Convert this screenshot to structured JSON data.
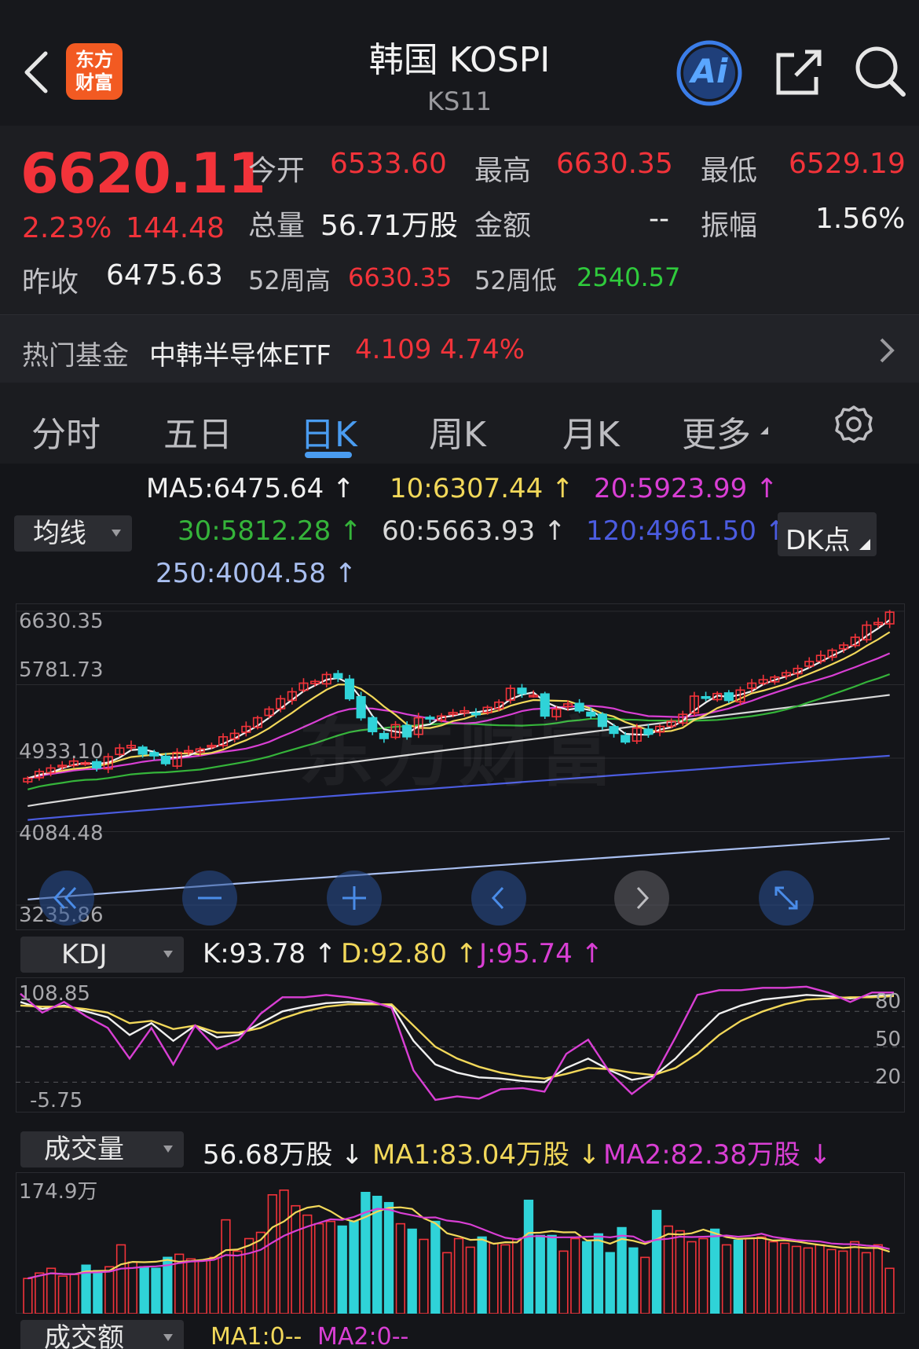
{
  "header": {
    "logo_line1": "东方",
    "logo_line2": "财富",
    "title": "韩国 KOSPI",
    "code": "KS11",
    "ai_label": "Ai"
  },
  "quote": {
    "price": "6620.11",
    "change_pct": "2.23%",
    "change": "144.48",
    "prev_close_label": "昨收",
    "prev_close": "6475.63",
    "open_label": "今开",
    "open": "6533.60",
    "high_label": "最高",
    "high": "6630.35",
    "low_label": "最低",
    "low": "6529.19",
    "volume_label": "总量",
    "volume": "56.71万股",
    "amount_label": "金额",
    "amount": "--",
    "amplitude_label": "振幅",
    "amplitude": "1.56%",
    "wk52_high_label": "52周高",
    "wk52_high": "6630.35",
    "wk52_low_label": "52周低",
    "wk52_low": "2540.57"
  },
  "fund": {
    "label": "热门基金",
    "name": "中韩半导体ETF",
    "price": "4.109",
    "pct": "4.74%"
  },
  "tabs": [
    "分时",
    "五日",
    "日K",
    "周K",
    "月K",
    "更多"
  ],
  "ma": {
    "selector": "均线",
    "dk_label": "DK点",
    "items": [
      {
        "text": "MA5:6475.64 ↑",
        "color": "#f0f0f0"
      },
      {
        "text": "10:6307.44 ↑",
        "color": "#f2d85a"
      },
      {
        "text": "20:5923.99 ↑",
        "color": "#d93fd4"
      },
      {
        "text": "30:5812.28 ↑",
        "color": "#35b43a"
      },
      {
        "text": "60:5663.93 ↑",
        "color": "#d8d8d8"
      },
      {
        "text": "120:4961.50 ↑",
        "color": "#4b5ce0"
      },
      {
        "text": "250:4004.58 ↑",
        "color": "#a9bff0"
      }
    ]
  },
  "kline_axis": [
    "6630.35",
    "5781.73",
    "4933.10",
    "4084.48",
    "3235.86"
  ],
  "watermark": "东方财富",
  "kdj": {
    "selector": "KDJ",
    "k": "K:93.78 ↑",
    "d": "D:92.80 ↑",
    "j": "J:95.74 ↑",
    "axis_top": "108.85",
    "axis_bottom": "-5.75",
    "levels": [
      "80",
      "50",
      "20"
    ]
  },
  "volume": {
    "selector": "成交量",
    "vol": "56.68万股 ↓",
    "ma1": "MA1:83.04万股 ↓",
    "ma2": "MA2:82.38万股 ↓",
    "axis_top": "174.9万"
  },
  "amount_panel": {
    "selector": "成交额",
    "ma1": "MA1:0--",
    "ma2": "MA2:0--"
  },
  "colors": {
    "up": "#f2333a",
    "down": "#2fd3d8",
    "accent": "#4a9cf0"
  },
  "chart_data": [
    {
      "type": "candlestick",
      "title": "",
      "ylim": [
        3235.86,
        6630.35
      ],
      "y_ticks": [
        6630.35,
        5781.73,
        4933.1,
        4084.48,
        3235.86
      ],
      "series_close": [
        4700,
        4780,
        4820,
        4850,
        4900,
        4880,
        4820,
        4950,
        5050,
        5080,
        4980,
        4960,
        4870,
        5000,
        5020,
        5040,
        5080,
        5180,
        5220,
        5300,
        5400,
        5500,
        5620,
        5700,
        5800,
        5820,
        5900,
        5860,
        5620,
        5400,
        5240,
        5160,
        5320,
        5180,
        5400,
        5390,
        5420,
        5460,
        5480,
        5450,
        5520,
        5580,
        5740,
        5680,
        5660,
        5420,
        5500,
        5560,
        5480,
        5420,
        5300,
        5220,
        5120,
        5280,
        5210,
        5300,
        5360,
        5440,
        5650,
        5640,
        5680,
        5600,
        5720,
        5800,
        5840,
        5870,
        5920,
        5970,
        6050,
        6120,
        6180,
        6240,
        6330,
        6470,
        6500,
        6620
      ],
      "ma_latest": {
        "MA5": 6475.64,
        "MA10": 6307.44,
        "MA20": 5923.99,
        "MA30": 5812.28,
        "MA60": 5663.93,
        "MA120": 4961.5,
        "MA250": 4004.58
      }
    },
    {
      "type": "line",
      "title": "",
      "ylim": [
        -5.75,
        108.85
      ],
      "series": [
        {
          "name": "K",
          "values": [
            88,
            82,
            85,
            80,
            75,
            60,
            70,
            55,
            68,
            58,
            60,
            70,
            80,
            84,
            87,
            88,
            87,
            85,
            55,
            35,
            28,
            24,
            23,
            21,
            20,
            32,
            40,
            30,
            22,
            25,
            40,
            60,
            78,
            85,
            90,
            92,
            94,
            93,
            91,
            93,
            94
          ]
        },
        {
          "name": "D",
          "values": [
            85,
            84,
            84,
            82,
            79,
            70,
            72,
            65,
            68,
            62,
            62,
            66,
            74,
            80,
            84,
            86,
            86,
            86,
            68,
            50,
            40,
            33,
            28,
            25,
            23,
            27,
            32,
            31,
            28,
            26,
            32,
            44,
            60,
            72,
            80,
            86,
            90,
            91,
            92,
            92,
            93
          ]
        },
        {
          "name": "J",
          "values": [
            95,
            79,
            88,
            76,
            66,
            40,
            66,
            35,
            68,
            48,
            56,
            78,
            92,
            92,
            94,
            92,
            89,
            83,
            30,
            5,
            8,
            6,
            14,
            15,
            12,
            44,
            56,
            28,
            10,
            24,
            58,
            94,
            98,
            98,
            100,
            100,
            101,
            96,
            88,
            96,
            96
          ]
        }
      ]
    },
    {
      "type": "bar",
      "title": "",
      "ylim": [
        0,
        174.9
      ],
      "series": [
        {
          "name": "成交量",
          "values": [
            45,
            52,
            58,
            48,
            50,
            62,
            55,
            60,
            88,
            66,
            60,
            58,
            72,
            76,
            70,
            68,
            72,
            120,
            80,
            96,
            104,
            152,
            158,
            138,
            126,
            115,
            118,
            112,
            118,
            155,
            150,
            142,
            115,
            108,
            95,
            118,
            78,
            96,
            85,
            98,
            90,
            88,
            95,
            145,
            100,
            100,
            80,
            96,
            92,
            102,
            78,
            110,
            84,
            72,
            132,
            112,
            106,
            92,
            96,
            108,
            88,
            94,
            96,
            98,
            92,
            90,
            86,
            84,
            88,
            82,
            80,
            92,
            78,
            88,
            58
          ]
        }
      ],
      "ma": {
        "MA1": "83.04万股",
        "MA2": "82.38万股"
      }
    }
  ]
}
